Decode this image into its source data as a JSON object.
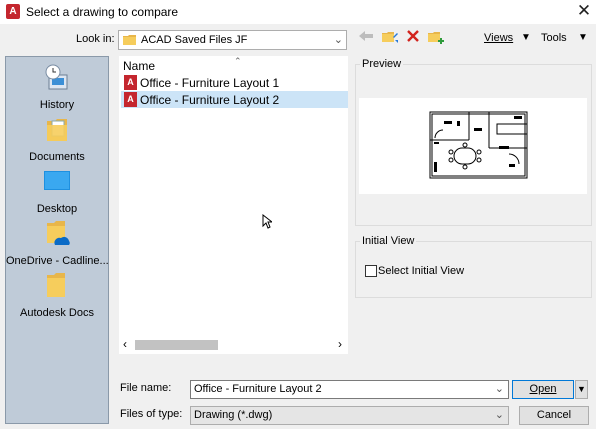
{
  "window": {
    "title": "Select a drawing to compare",
    "app_icon_letter": "A",
    "close_glyph": "✕"
  },
  "lookin": {
    "label": "Look in:",
    "value": "ACAD Saved Files JF"
  },
  "toolbar": {
    "views_label": "Views",
    "tools_label": "Tools"
  },
  "places": [
    {
      "label": "History",
      "icon": "history-icon"
    },
    {
      "label": "Documents",
      "icon": "documents-folder-icon"
    },
    {
      "label": "Desktop",
      "icon": "desktop-icon"
    },
    {
      "label": "OneDrive - Cadline...",
      "icon": "onedrive-folder-icon"
    },
    {
      "label": "Autodesk Docs",
      "icon": "autodesk-docs-folder-icon"
    }
  ],
  "filelist": {
    "column_name": "Name",
    "files": [
      {
        "name": "Office - Furniture Layout 1",
        "selected": false
      },
      {
        "name": "Office - Furniture Layout 2",
        "selected": true
      }
    ]
  },
  "preview": {
    "label": "Preview"
  },
  "initial_view": {
    "label": "Initial View",
    "checkbox_label": "Select Initial View",
    "checked": false
  },
  "filename": {
    "label": "File name:",
    "value": "Office - Furniture Layout 2"
  },
  "filetype": {
    "label": "Files of type:",
    "value": "Drawing (*.dwg)"
  },
  "buttons": {
    "open": "Open",
    "cancel": "Cancel"
  },
  "colors": {
    "selection": "#cce4f7",
    "places_bg": "#bfcbd8",
    "dwg_red": "#c4262e",
    "accent": "#0078d7"
  }
}
